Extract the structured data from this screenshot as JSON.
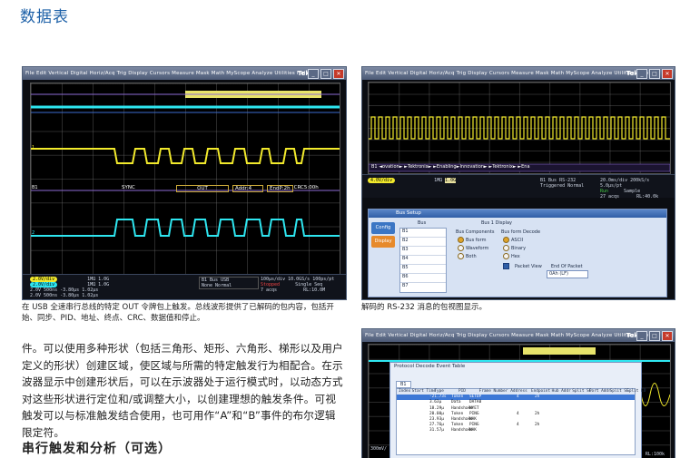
{
  "page": {
    "title": "数据表"
  },
  "scope_menu": {
    "items": "File  Edit  Vertical  Digital  Horiz/Acq  Trig  Display  Cursors  Measure  Mask  Math  MyScope  Analyze  Utilities  Help",
    "brand": "Tek",
    "minimize": "_",
    "restore": "□",
    "close": "✕"
  },
  "screenshot1": {
    "bus_labels": [
      "SYNC",
      "OUT",
      "Addr:4",
      "EndP:2h",
      "CRC5:00h"
    ],
    "channel_markers": [
      "B1",
      "1",
      "2"
    ],
    "status": {
      "ch1": "2.0V/div",
      "ch1_imp": "1MΩ",
      "ch1_bw": "1.0G",
      "ch2": "2.0V/div",
      "ch2_imp": "1MΩ",
      "ch2_bw": "1.0G",
      "row3": "2.0V     500ns  -3.80µs  1.02µs",
      "row4": "2.0V     500ns  -3.80µs  1.02µs",
      "bus_label": "B1  Bus   USB",
      "bus_mode": "None         Normal",
      "timebase": "100µs/div  10.0GS/s      100ps/pt",
      "trigger_state": "Stopped",
      "acq_mode": "Single Seq",
      "acqs": "7 acqs",
      "record_length": "RL:10.0M"
    }
  },
  "caption1": "在 USB 全速串行总线的特定 OUT 令牌包上触发。总线波形提供了已解码的包内容，包括开始、同步、PID、地址、终点、CRC、数据值和停止。",
  "screenshot2": {
    "bus_text": "B1  ◄ovation►  ►Tektronix►  ►Enabling►Innovation►  ►Tektronix►  ►Ena",
    "status": {
      "ch1": "4.0V/div",
      "ch1_imp": "1MΩ",
      "ch1_bw": "1.0G",
      "bus_info": "B1  Bus   RS-232",
      "bus_state": "Triggered   Normal",
      "timebase": "20.0ms/div  200kS/s   5.0µs/pt",
      "trigger_state": "Run",
      "acq_mode": "Sample",
      "acqs": "27 acqs",
      "record_length": "RL:40.0k"
    },
    "dialog": {
      "title": "Bus Setup",
      "tabs": [
        "Config",
        "Display"
      ],
      "bus_heading": "Bus",
      "bus_items": [
        "B1",
        "B2",
        "B3",
        "B4",
        "B5",
        "B6",
        "B7"
      ],
      "display_heading": "Bus 1 Display",
      "components_heading": "Bus Components",
      "components": [
        "Bus form",
        "Waveform",
        "Both"
      ],
      "decode_heading": "Bus form Decode",
      "decode_options": [
        "ASCII",
        "Binary",
        "Hex"
      ],
      "packet_view_label": "Packet View",
      "end_of_packet_label": "End Of Packet",
      "end_of_packet_value": "0Ah (LF)"
    }
  },
  "caption2": "解码的 RS-232 消息的包视图显示。",
  "screenshot3": {
    "table_title": "Protocol Decode Event Table",
    "tab": "B1",
    "headers": [
      "Index",
      "Start Time",
      "Type",
      "PID",
      "Frame Number",
      "Address",
      "Endpoint",
      "Hub Addr",
      "Split SC",
      "Port Addr",
      "Split SE",
      "Split ET",
      "D"
    ],
    "rows": [
      {
        "time": "-21.73s",
        "type": "Token",
        "pid": "SETUP",
        "addr": "4",
        "ep": "2h"
      },
      {
        "time": "3.63µ",
        "type": "Data",
        "pid": "DATA0",
        "addr": "",
        "ep": ""
      },
      {
        "time": "18.29µ",
        "type": "Handshake",
        "pid": "NYET",
        "addr": "",
        "ep": ""
      },
      {
        "time": "20.00µ",
        "type": "Token",
        "pid": "PING",
        "addr": "4",
        "ep": "2h"
      },
      {
        "time": "23.93µ",
        "type": "Handshake",
        "pid": "NAK",
        "addr": "",
        "ep": ""
      },
      {
        "time": "27.76µ",
        "type": "Token",
        "pid": "PING",
        "addr": "4",
        "ep": "2h"
      },
      {
        "time": "31.57µ",
        "type": "Handshake",
        "pid": "NAK",
        "addr": "",
        "ep": ""
      }
    ],
    "status_left": "300mV/",
    "record_length": "RL:100k"
  },
  "body_text": "件。可以使用多种形状（包括三角形、矩形、六角形、梯形以及用户定义的形状）创建区域，使区域与所需的特定触发行为相配合。在示波器显示中创建形状后，可以在示波器处于运行模式时，以动态方式对这些形状进行定位和/或调整大小，以创建理想的触发条件。可视触发可以与标准触发结合使用，也可用作“A”和“B”事件的布尔逻辑限定符。",
  "section_heading": "串行触发和分析（可选）",
  "colors": {
    "title_blue": "#1e61a8",
    "ch1_yellow": "#f2ea2c",
    "ch2_cyan": "#2ee6f0",
    "bus_purple": "#8e6bd6",
    "dialog_blue": "#d7e2f3"
  }
}
